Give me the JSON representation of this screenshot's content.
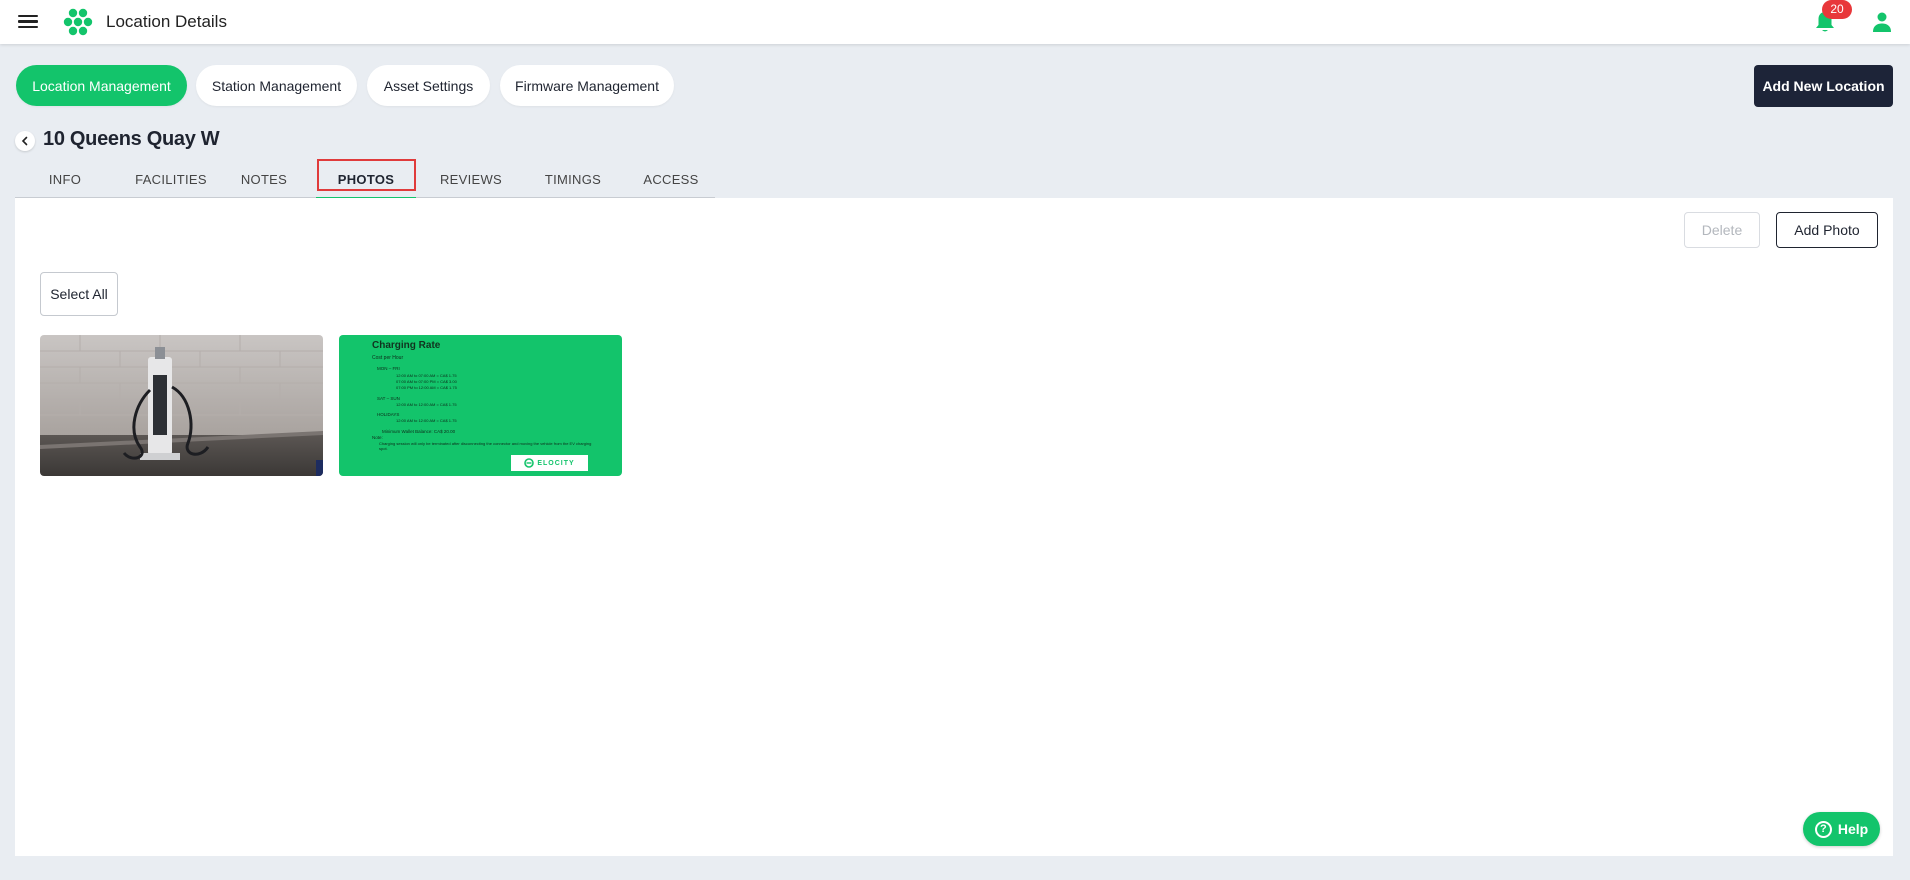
{
  "header": {
    "title": "Location Details",
    "notification_count": "20"
  },
  "nav_pills": [
    {
      "label": "Location Management",
      "active": true
    },
    {
      "label": "Station Management",
      "active": false
    },
    {
      "label": "Asset Settings",
      "active": false
    },
    {
      "label": "Firmware Management",
      "active": false
    }
  ],
  "actions": {
    "add_location_label": "Add New Location"
  },
  "location": {
    "name": "10 Queens Quay W"
  },
  "tabs": [
    {
      "label": "INFO"
    },
    {
      "label": "FACILITIES"
    },
    {
      "label": "NOTES"
    },
    {
      "label": "PHOTOS"
    },
    {
      "label": "REVIEWS"
    },
    {
      "label": "TIMINGS"
    },
    {
      "label": "ACCESS"
    }
  ],
  "active_tab": "PHOTOS",
  "photos_panel": {
    "delete_label": "Delete",
    "add_photo_label": "Add Photo",
    "select_all_label": "Select All"
  },
  "photos": {
    "charger_photo": {
      "subject": "charging station against brick wall"
    },
    "rate_card": {
      "title": "Charging Rate",
      "subtitle": "Cost per Hour",
      "sections": [
        {
          "heading": "MON – FRI",
          "lines": [
            "12:00 AM to 07:00 AM = CA$ 1.75",
            "07:00 AM to 07:00 PM = CA$ 3.00",
            "07:00 PM to 12:00 AM = CA$ 1.75"
          ]
        },
        {
          "heading": "SAT – SUN",
          "lines": [
            "12:00 AM to 12:00 AM = CA$ 1.75"
          ]
        },
        {
          "heading": "HOLIDAYS",
          "lines": [
            "12:00 AM to 12:00 AM = CA$ 1.75"
          ]
        }
      ],
      "min_balance": "Minimum Wallet Balance: CA$ 20.00",
      "note_heading": "Note:",
      "note": "Charging session will only be terminated after disconnecting the connector and moving the vehicle from the EV charging spot.",
      "brand": "ELOCITY"
    }
  },
  "help_label": "Help",
  "colors": {
    "accent": "#13c46b",
    "dark": "#1d2438",
    "badge": "#e8373a",
    "highlight": "#e03b3b"
  }
}
